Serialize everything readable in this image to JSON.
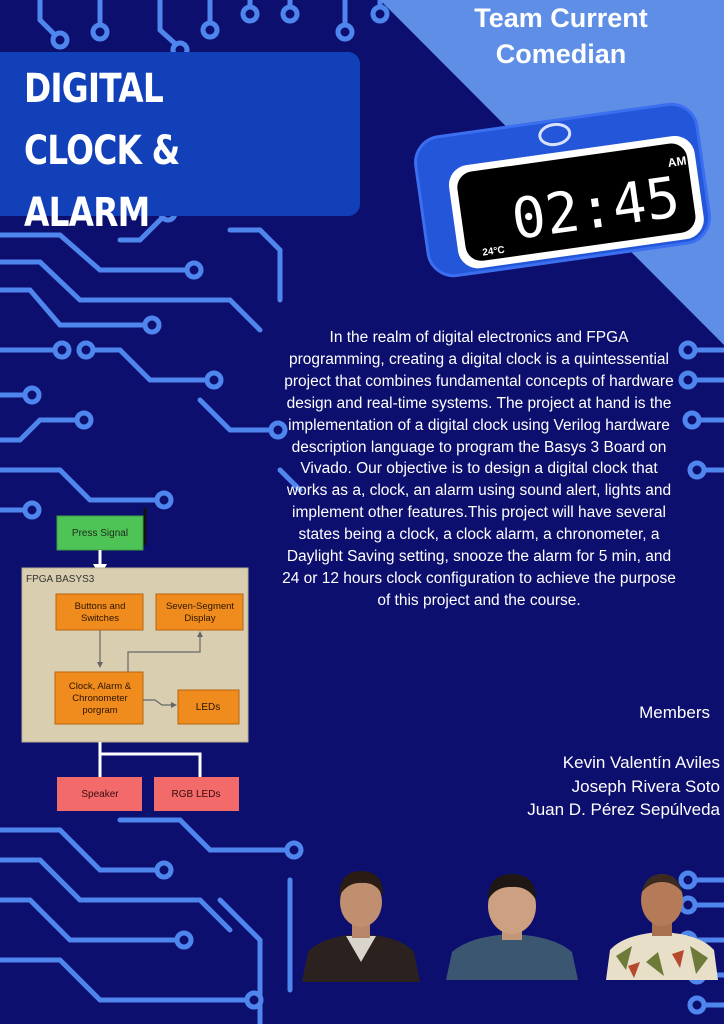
{
  "title": {
    "line1": "DIGITAL CLOCK &",
    "line2": "ALARM"
  },
  "team": {
    "line1": "Team Current",
    "line2": "Comedian"
  },
  "clock": {
    "time": "02:45",
    "period": "AM",
    "temperature": "24°C"
  },
  "description": "In the realm of digital electronics and FPGA programming, creating a digital clock is a quintessential project that combines fundamental concepts of hardware design and real-time systems. The project at hand is the implementation of a digital clock using Verilog hardware description language to program the Basys 3 Board on Vivado. Our objective is to design a digital clock that works as a, clock, an alarm using sound alert, lights and implement other features.This project will have several states being a clock, a clock alarm, a chronometer, a Daylight Saving setting, snooze the alarm for 5 min, and 24 or 12 hours clock configuration to achieve the purpose of this project and the course.",
  "diagram": {
    "press_signal": "Press Signal",
    "board_label": "FPGA BASYS3",
    "buttons": [
      "Buttons and",
      "Switches"
    ],
    "seven_segment": [
      "Seven-Segment",
      "Display"
    ],
    "core": [
      "Clock, Alarm &",
      "Chronometer",
      "porgram"
    ],
    "leds": "LEDs",
    "speaker": "Speaker",
    "rgb_leds": "RGB LEDs"
  },
  "members": {
    "heading": "Members",
    "names": [
      "Kevin Valentín Aviles",
      "Joseph Rivera Soto",
      "Juan D. Pérez Sepúlveda"
    ]
  },
  "colors": {
    "background": "#0d0f6e",
    "circuit": "#4f86ee",
    "banner": "#1240b8",
    "corner": "#5f8ee6",
    "press_signal": "#4fc456",
    "board": "#d9cfb0",
    "block": "#f08c1e",
    "output": "#f26a6a"
  }
}
